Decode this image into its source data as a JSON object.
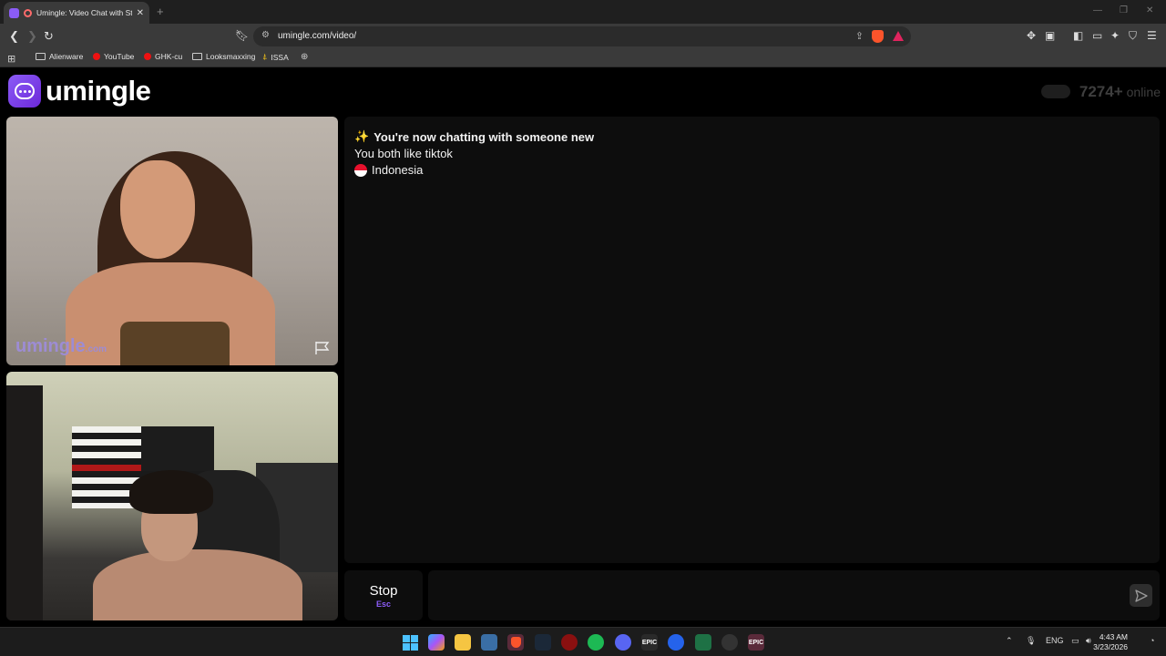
{
  "browser": {
    "tab_title": "Umingle: Video Chat with Stra",
    "url": "umingle.com/video/",
    "bookmarks": [
      "Alienware",
      "YouTube",
      "GHK-cu",
      "Looksmaxxing",
      "ISSA"
    ]
  },
  "page": {
    "logo_text": "umingle",
    "online_count": "7274+",
    "online_label": "online",
    "watermark_main": "umingle",
    "watermark_suffix": ".com"
  },
  "chat": {
    "messages": [
      {
        "icon": "sparkles",
        "text": "You're now chatting with someone new"
      },
      {
        "text": "You both like tiktok"
      },
      {
        "icon": "flag-indonesia",
        "text": "Indonesia"
      }
    ],
    "stop_label": "Stop",
    "stop_hotkey": "Esc",
    "input_value": ""
  },
  "taskbar": {
    "language": "ENG",
    "time": "4:43 AM",
    "date": "3/23/2026"
  },
  "colors": {
    "brand": "#8b5cf6",
    "chat_bg": "#0d0d0d",
    "page_bg": "#000000"
  }
}
